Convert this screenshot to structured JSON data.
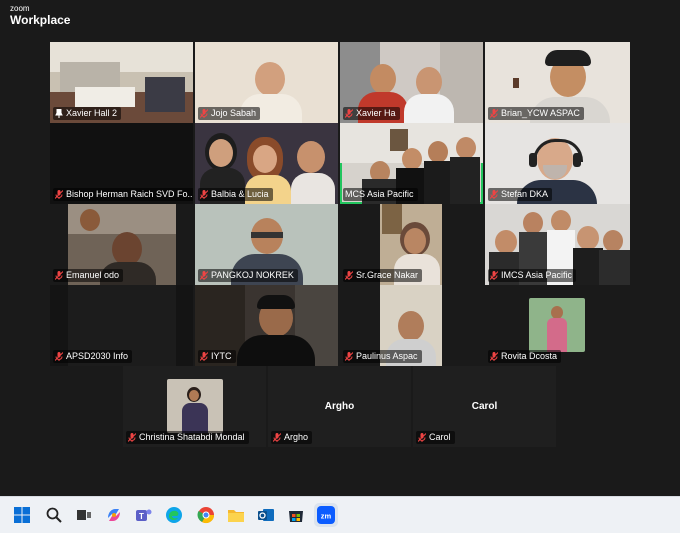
{
  "brand": {
    "small": "zoom",
    "large": "Workplace"
  },
  "participants": [
    {
      "name": "Xavier Hall 2",
      "muted": false,
      "pinned": true
    },
    {
      "name": "Jojo Sabah",
      "muted": true,
      "pinned": false
    },
    {
      "name": "Xavier Ha",
      "muted": true,
      "pinned": false
    },
    {
      "name": "Brian_YCW ASPAC",
      "muted": true,
      "pinned": false
    },
    {
      "name": "Bishop Herman Raich SVD Fo...",
      "muted": true,
      "pinned": false
    },
    {
      "name": "Balbia & Lucia",
      "muted": true,
      "pinned": false
    },
    {
      "name": "MCS Asia Pacific",
      "muted": false,
      "pinned": false,
      "active_speaker": true
    },
    {
      "name": "Stefan DKA",
      "muted": true,
      "pinned": false
    },
    {
      "name": "Emanuel odo",
      "muted": true,
      "pinned": false
    },
    {
      "name": "PANGKOJ NOKREK",
      "muted": true,
      "pinned": false
    },
    {
      "name": "Sr.Grace Nakar",
      "muted": true,
      "pinned": false
    },
    {
      "name": "IMCS Asia Pacific",
      "muted": true,
      "pinned": false
    },
    {
      "name": "APSD2030 Info",
      "muted": true,
      "pinned": false
    },
    {
      "name": "IYTC",
      "muted": true,
      "pinned": false
    },
    {
      "name": "Paulinus Aspac",
      "muted": true,
      "pinned": false
    },
    {
      "name": "Rovita Dcosta",
      "muted": true,
      "pinned": false
    },
    {
      "name": "Christina Shatabdi Mondal",
      "muted": true,
      "pinned": false
    },
    {
      "name": "Argho",
      "muted": true,
      "pinned": false
    },
    {
      "name": "Carol",
      "muted": true,
      "pinned": false
    }
  ],
  "center_names": {
    "argho": "Argho",
    "carol": "Carol"
  },
  "colors": {
    "muted_icon": "#ef4444",
    "active_border": "#22c55e"
  },
  "taskbar": [
    "windows-start-icon",
    "search-icon",
    "task-view-icon",
    "copilot-icon",
    "teams-icon",
    "edge-icon",
    "chrome-icon",
    "file-explorer-icon",
    "outlook-icon",
    "store-icon",
    "zoom-icon"
  ]
}
